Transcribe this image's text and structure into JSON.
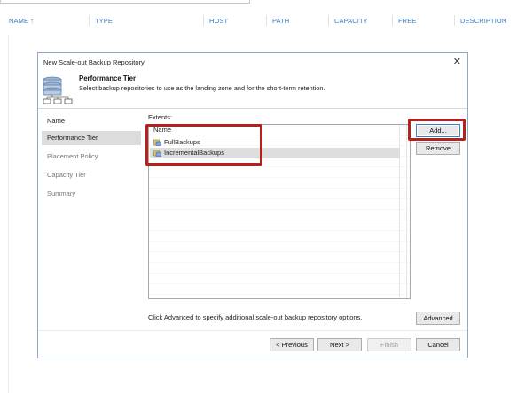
{
  "background": {
    "columns": [
      "NAME",
      "TYPE",
      "HOST",
      "PATH",
      "CAPACITY",
      "FREE",
      "DESCRIPTION"
    ],
    "sort_arrow": "↑"
  },
  "dialog": {
    "title": "New Scale-out Backup Repository",
    "close_glyph": "✕",
    "heading": "Performance Tier",
    "subheading": "Select backup repositories to use as the landing zone and for the short-term retention.",
    "header_icon": "repository-stack-icon"
  },
  "nav": {
    "items": [
      "Name",
      "Performance Tier",
      "Placement Policy",
      "Capacity Tier",
      "Summary"
    ],
    "active_index": 1
  },
  "extents": {
    "label": "Extents:",
    "column_header": "Name",
    "rows": [
      {
        "name": "FullBackups",
        "icon": "repository-icon",
        "selected": false
      },
      {
        "name": "IncrementalBackups",
        "icon": "repository-icon",
        "selected": true
      }
    ]
  },
  "buttons": {
    "add": "Add...",
    "remove": "Remove",
    "advanced": "Advanced",
    "previous": "< Previous",
    "next": "Next >",
    "finish": "Finish",
    "cancel": "Cancel"
  },
  "hint": "Click Advanced to specify additional scale-out backup repository options.",
  "colors": {
    "accent": "#3a7abf",
    "highlight": "#b5221d",
    "selection": "#dedede"
  }
}
